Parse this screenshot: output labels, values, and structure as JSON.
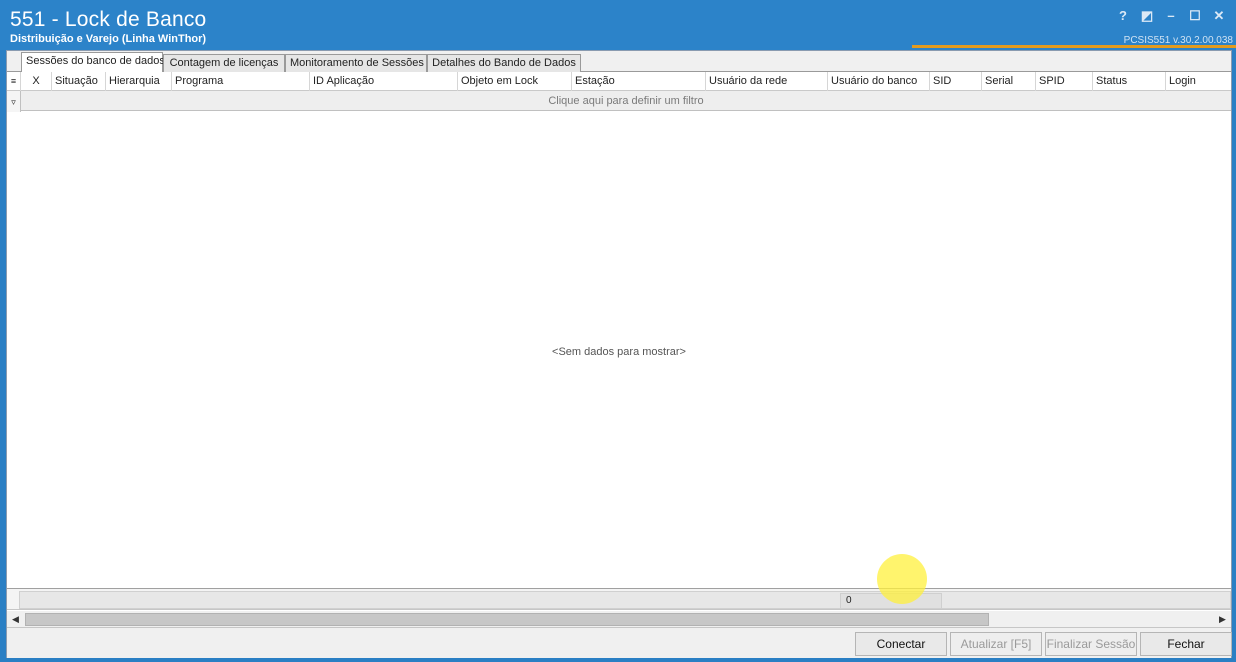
{
  "window": {
    "title": "551 - Lock de Banco",
    "subtitle": "Distribuição e Varejo (Linha WinThor)",
    "version": "PCSIS551  v.30.2.00.038",
    "controls": [
      "?",
      "◩",
      "–",
      "☐",
      "✕"
    ]
  },
  "tabs": [
    "Sessões do banco de dados",
    "Contagem de licenças",
    "Monitoramento de Sessões",
    "Detalhes do Bando de Dados"
  ],
  "grid": {
    "columns": [
      "X",
      "Situação",
      "Hierarquia",
      "Programa",
      "ID Aplicação",
      "Objeto em Lock",
      "Estação",
      "Usuário da rede",
      "Usuário do banco",
      "SID",
      "Serial",
      "SPID",
      "Status",
      "Login"
    ],
    "filter_text": "Clique aqui para definir um filtro",
    "empty_text": "<Sem dados para mostrar>",
    "count": "0"
  },
  "buttons": {
    "connect": "Conectar",
    "refresh": "Atualizar [F5]",
    "end_session": "Finalizar Sessão",
    "close": "Fechar"
  },
  "icons": {
    "column_chooser": "column-chooser-icon",
    "filter": "filter-icon",
    "scroll_left": "scroll-left-arrow-icon",
    "scroll_right": "scroll-right-arrow-icon"
  }
}
